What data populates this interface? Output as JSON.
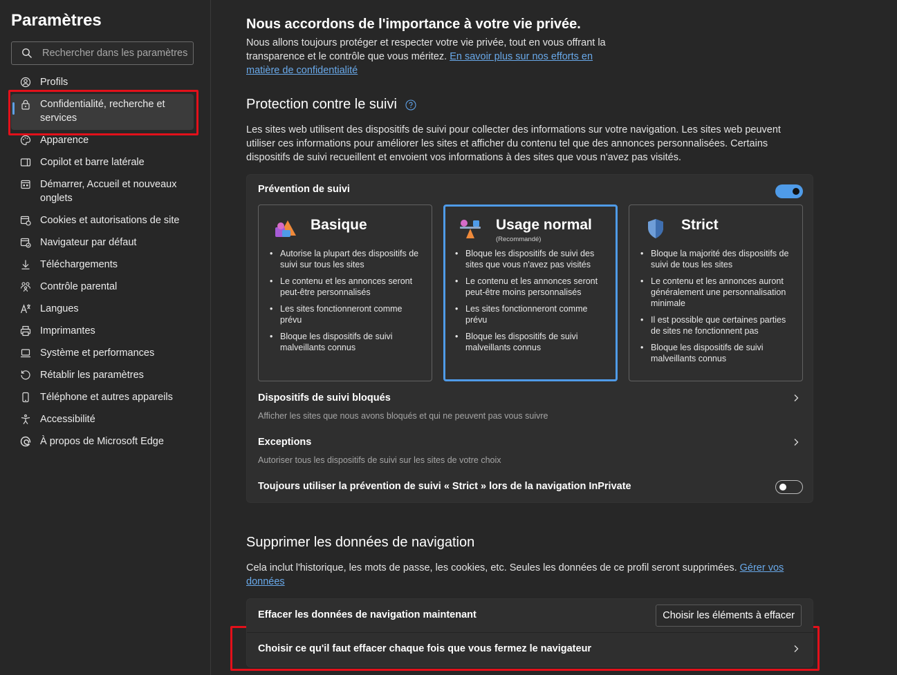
{
  "sidebar": {
    "title": "Paramètres",
    "search_placeholder": "Rechercher dans les paramètres",
    "items": [
      {
        "label": "Profils",
        "icon": "profile-icon"
      },
      {
        "label": "Confidentialité, recherche et services",
        "icon": "lock-icon",
        "active": true
      },
      {
        "label": "Apparence",
        "icon": "palette-icon"
      },
      {
        "label": "Copilot et barre latérale",
        "icon": "sidebar-icon"
      },
      {
        "label": "Démarrer, Accueil et nouveaux onglets",
        "icon": "home-tabs-icon"
      },
      {
        "label": "Cookies et autorisations de site",
        "icon": "cookies-icon"
      },
      {
        "label": "Navigateur par défaut",
        "icon": "default-browser-icon"
      },
      {
        "label": "Téléchargements",
        "icon": "download-icon"
      },
      {
        "label": "Contrôle parental",
        "icon": "family-icon"
      },
      {
        "label": "Langues",
        "icon": "languages-icon"
      },
      {
        "label": "Imprimantes",
        "icon": "printer-icon"
      },
      {
        "label": "Système et performances",
        "icon": "laptop-icon"
      },
      {
        "label": "Rétablir les paramètres",
        "icon": "reset-icon"
      },
      {
        "label": "Téléphone et autres appareils",
        "icon": "phone-icon"
      },
      {
        "label": "Accessibilité",
        "icon": "accessibility-icon"
      },
      {
        "label": "À propos de Microsoft Edge",
        "icon": "edge-icon"
      }
    ]
  },
  "privacy": {
    "heading": "Nous accordons de l'importance à votre vie privée.",
    "text": "Nous allons toujours protéger et respecter votre vie privée, tout en vous offrant la transparence et le contrôle que vous méritez.",
    "link": "En savoir plus sur nos efforts en matière de confidentialité"
  },
  "tracking": {
    "heading": "Protection contre le suivi",
    "description": "Les sites web utilisent des dispositifs de suivi pour collecter des informations sur votre navigation. Les sites web peuvent utiliser ces informations pour améliorer les sites et afficher du contenu tel que des annonces personnalisées. Certains dispositifs de suivi recueillent et envoient vos informations à des sites que vous n'avez pas visités.",
    "prevention_label": "Prévention de suivi",
    "prevention_enabled": true,
    "options": [
      {
        "name": "Basique",
        "subtitle": "",
        "selected": false,
        "bullets": [
          "Autorise la plupart des dispositifs de suivi sur tous les sites",
          "Le contenu et les annonces seront peut-être personnalisés",
          "Les sites fonctionneront comme prévu",
          "Bloque les dispositifs de suivi malveillants connus"
        ]
      },
      {
        "name": "Usage normal",
        "subtitle": "(Recommandé)",
        "selected": true,
        "bullets": [
          "Bloque les dispositifs de suivi des sites que vous n'avez pas visités",
          "Le contenu et les annonces seront peut-être moins personnalisés",
          "Les sites fonctionneront comme prévu",
          "Bloque les dispositifs de suivi malveillants connus"
        ]
      },
      {
        "name": "Strict",
        "subtitle": "",
        "selected": false,
        "bullets": [
          "Bloque la majorité des dispositifs de suivi de tous les sites",
          "Le contenu et les annonces auront généralement une personnalisation minimale",
          "Il est possible que certaines parties de sites ne fonctionnent pas",
          "Bloque les dispositifs de suivi malveillants connus"
        ]
      }
    ],
    "blocked_title": "Dispositifs de suivi bloqués",
    "blocked_sub": "Afficher les sites que nous avons bloqués et qui ne peuvent pas vous suivre",
    "exceptions_title": "Exceptions",
    "exceptions_sub": "Autoriser tous les dispositifs de suivi sur les sites de votre choix",
    "inprivate_label": "Toujours utiliser la prévention de suivi « Strict » lors de la navigation InPrivate",
    "inprivate_enabled": false
  },
  "clear": {
    "heading": "Supprimer les données de navigation",
    "text": "Cela inclut l'historique, les mots de passe, les cookies, etc. Seules les données de ce profil seront supprimées.",
    "link": "Gérer vos données",
    "now_label": "Effacer les données de navigation maintenant",
    "choose_button": "Choisir les éléments à effacer",
    "on_close_label": "Choisir ce qu'il faut effacer chaque fois que vous fermez le navigateur"
  },
  "colors": {
    "accent": "#4f9be8",
    "link": "#69a9ea",
    "highlight": "#e3101a",
    "background": "#272727",
    "card": "#2f2f2f"
  }
}
